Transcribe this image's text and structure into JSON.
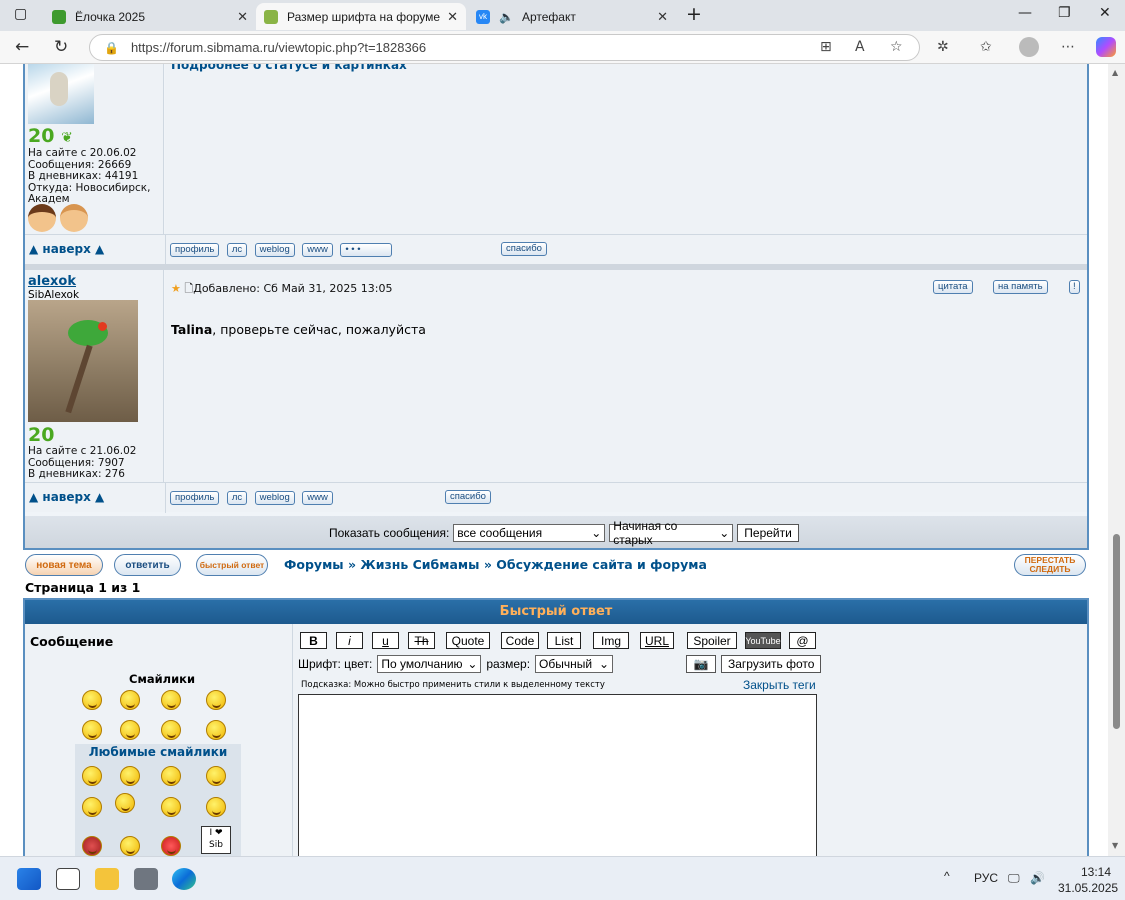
{
  "browser": {
    "tabs": [
      {
        "label": "Ёлочка 2025",
        "active": false
      },
      {
        "label": "Размер шрифта на форуме :: Сибм",
        "active": true
      },
      {
        "label": "Артефакт",
        "active": false
      }
    ],
    "url": "https://forum.sibmama.ru/viewtopic.php?t=1828366"
  },
  "post1": {
    "partial_title": "Подробнее о статусе и картинках",
    "level": "20",
    "since": "На сайте с 20.06.02",
    "messages": "Сообщения: 26669",
    "diaries": "В дневниках: 44191",
    "from": "Откуда: Новосибирск, Академ",
    "nav_up": "▲ наверх ▲",
    "buttons": [
      "профиль",
      "лс",
      "weblog",
      "www",
      "• • •"
    ],
    "thanks": "спасибо"
  },
  "post2": {
    "author": "alexok",
    "nick": "SibAlexok",
    "level": "20",
    "since": "На сайте с 21.06.02",
    "messages": "Сообщения: 7907",
    "diaries": "В дневниках: 276",
    "added": "Добавлено: Сб Май 31, 2025 13:05",
    "quote_btn": "цитата",
    "remember_btn": "на память",
    "addressee": "Talina",
    "body": ", проверьте сейчас, пожалуйста",
    "nav_up": "▲ наверх ▲",
    "buttons": [
      "профиль",
      "лс",
      "weblog",
      "www"
    ],
    "thanks": "спасибо"
  },
  "filter": {
    "label": "Показать сообщения:",
    "show_value": "все сообщения",
    "order_value": "Начиная со старых",
    "go": "Перейти"
  },
  "actions": {
    "new_topic": "новая тема",
    "reply": "ответить",
    "quick_reply": "быстрый ответ",
    "stop_follow": "ПЕРЕСТАТЬ СЛЕДИТЬ"
  },
  "breadcrumb": {
    "forums": "Форумы",
    "sep": "»",
    "life": "Жизнь Сибмамы",
    "discussion": "Обсуждение сайта и форума"
  },
  "pagination": "Страница 1 из 1",
  "quick": {
    "title": "Быстрый ответ",
    "message_label": "Сообщение",
    "smilies_label": "Смайлики",
    "fav_smilies_label": "Любимые смайлики",
    "tags": [
      "B",
      "i",
      "u",
      "Th",
      "Quote",
      "Code",
      "List",
      "Img",
      "URL",
      "Spoiler",
      "YouTube",
      "@"
    ],
    "font_label": "Шрифт: цвет:",
    "color_value": "По умолчанию",
    "size_label": "размер:",
    "size_value": "Обычный",
    "upload": "Загрузить фото",
    "hint": "Подсказка: Можно быстро применить стили к выделенному тексту",
    "close_tags": "Закрыть теги"
  },
  "taskbar": {
    "lang": "РУС",
    "time": "13:14",
    "date": "31.05.2025"
  }
}
